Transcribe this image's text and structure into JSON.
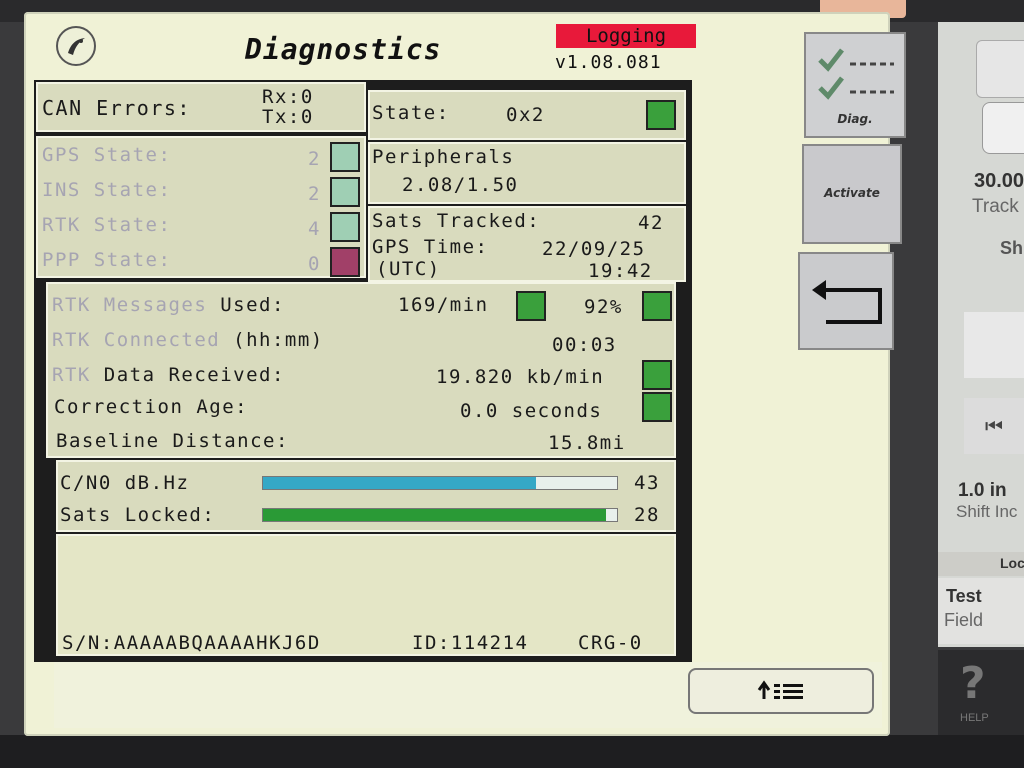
{
  "header": {
    "title": "Diagnostics",
    "logging_badge": "Logging",
    "version": "v1.08.081"
  },
  "can": {
    "label": "CAN Errors:",
    "rx": "Rx:0",
    "tx": "Tx:0"
  },
  "state": {
    "label": "State:",
    "value": "0x2"
  },
  "gnss_states": [
    {
      "label": "GPS State:",
      "value": "2"
    },
    {
      "label": "INS State:",
      "value": "2"
    },
    {
      "label": "RTK State:",
      "value": "4"
    },
    {
      "label": "PPP State:",
      "value": "0"
    }
  ],
  "peripherals": {
    "label": "Peripherals",
    "value": "2.08/1.50"
  },
  "sats": {
    "tracked_label": "Sats Tracked:",
    "tracked_value": "42",
    "time_label": "GPS Time:",
    "utc_label": "(UTC)",
    "date": "22/09/25",
    "time": "19:42"
  },
  "rtk": {
    "messages_used_label": "RTK Messages Used:",
    "messages_used_value": "169/min",
    "messages_used_pct": "92%",
    "connected_label": "RTK Connected (hh:mm)",
    "connected_value": "00:03",
    "data_received_label": "RTK Data Received:",
    "data_received_value": "19.820 kb/min",
    "correction_age_label": "Correction Age:",
    "correction_age_value": "0.0 seconds",
    "baseline_label": "Baseline Distance:",
    "baseline_value": "15.8mi"
  },
  "signal": {
    "cn0_label": "C/N0 dB.Hz",
    "cn0_value": "43",
    "cn0_fill": 0.77,
    "sats_locked_label": "Sats Locked:",
    "sats_locked_value": "28",
    "sats_locked_fill": 0.97
  },
  "footer": {
    "serial": "S/N:AAAAABQAAAAHKJ6D",
    "id": "ID:114214",
    "crg": "CRG-0"
  },
  "side_buttons": {
    "diag_label": "Diag.",
    "activate_label": "Activate"
  },
  "right_panel": {
    "speed": "30.00",
    "speed_caption": "Track",
    "section_cut": "Sh",
    "shift_value": "1.0 in",
    "shift_caption": "Shift Inc",
    "lock_header": "Loc",
    "field_line1": "Test",
    "field_line2": "Field",
    "help_label": "HELP"
  },
  "colors": {
    "status_green": "#3aa03c",
    "status_teal": "#9fcfb4",
    "status_maroon": "#a14068",
    "logging_red": "#e8193a",
    "cn0_bar": "#35a8c6",
    "sats_bar": "#2a9a36"
  }
}
